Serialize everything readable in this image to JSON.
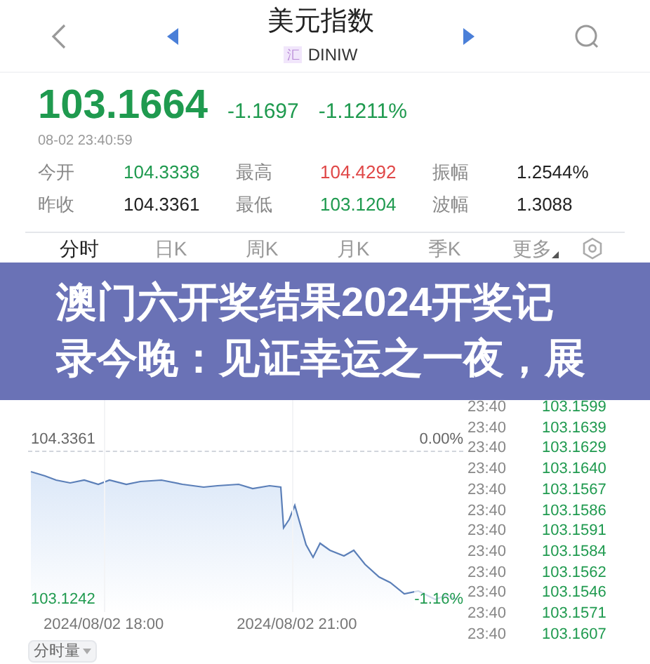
{
  "header": {
    "title": "美元指数",
    "badge": "汇",
    "symbol": "DINIW"
  },
  "quote": {
    "price": "103.1664",
    "change": "-1.1697",
    "change_pct": "-1.1211%",
    "time": "08-02 23:40:59"
  },
  "stats": [
    {
      "label": "今开",
      "value": "104.3338",
      "color": "#1f9a4f"
    },
    {
      "label": "最高",
      "value": "104.4292",
      "color": "#e04848"
    },
    {
      "label": "振幅",
      "value": "1.2544%",
      "color": "#222222"
    },
    {
      "label": "昨收",
      "value": "104.3361",
      "color": "#222222"
    },
    {
      "label": "最低",
      "value": "103.1204",
      "color": "#1f9a4f"
    },
    {
      "label": "波幅",
      "value": "1.3088",
      "color": "#222222"
    }
  ],
  "tabs": [
    {
      "label": "分时",
      "selected": true,
      "kind": "tab"
    },
    {
      "label": "日K",
      "selected": false,
      "kind": "tab"
    },
    {
      "label": "周K",
      "selected": false,
      "kind": "tab"
    },
    {
      "label": "月K",
      "selected": false,
      "kind": "tab"
    },
    {
      "label": "季K",
      "selected": false,
      "kind": "tab"
    },
    {
      "label": "更多",
      "selected": false,
      "kind": "menu"
    }
  ],
  "banner": {
    "lines": [
      "澳门六开奖结果2024开奖记",
      "录今晚：见证幸运之一夜，展"
    ]
  },
  "chart": {
    "ref_value": "104.3361",
    "ref_pct": "0.00%",
    "low_value": "103.1242",
    "low_pct": "-1.16%",
    "x_labels": [
      "2024/08/02 18:00",
      "2024/08/02 21:00"
    ]
  },
  "volume_button": "分时量",
  "ticks": [
    {
      "time": "23:40",
      "price": "103.1599"
    },
    {
      "time": "23:40",
      "price": "103.1639"
    },
    {
      "time": "23:40",
      "price": "103.1629"
    },
    {
      "time": "23:40",
      "price": "103.1640"
    },
    {
      "time": "23:40",
      "price": "103.1567"
    },
    {
      "time": "23:40",
      "price": "103.1586"
    },
    {
      "time": "23:40",
      "price": "103.1591"
    },
    {
      "time": "23:40",
      "price": "103.1584"
    },
    {
      "time": "23:40",
      "price": "103.1562"
    },
    {
      "time": "23:40",
      "price": "103.1546"
    },
    {
      "time": "23:40",
      "price": "103.1571"
    },
    {
      "time": "23:40",
      "price": "103.1607"
    }
  ]
}
